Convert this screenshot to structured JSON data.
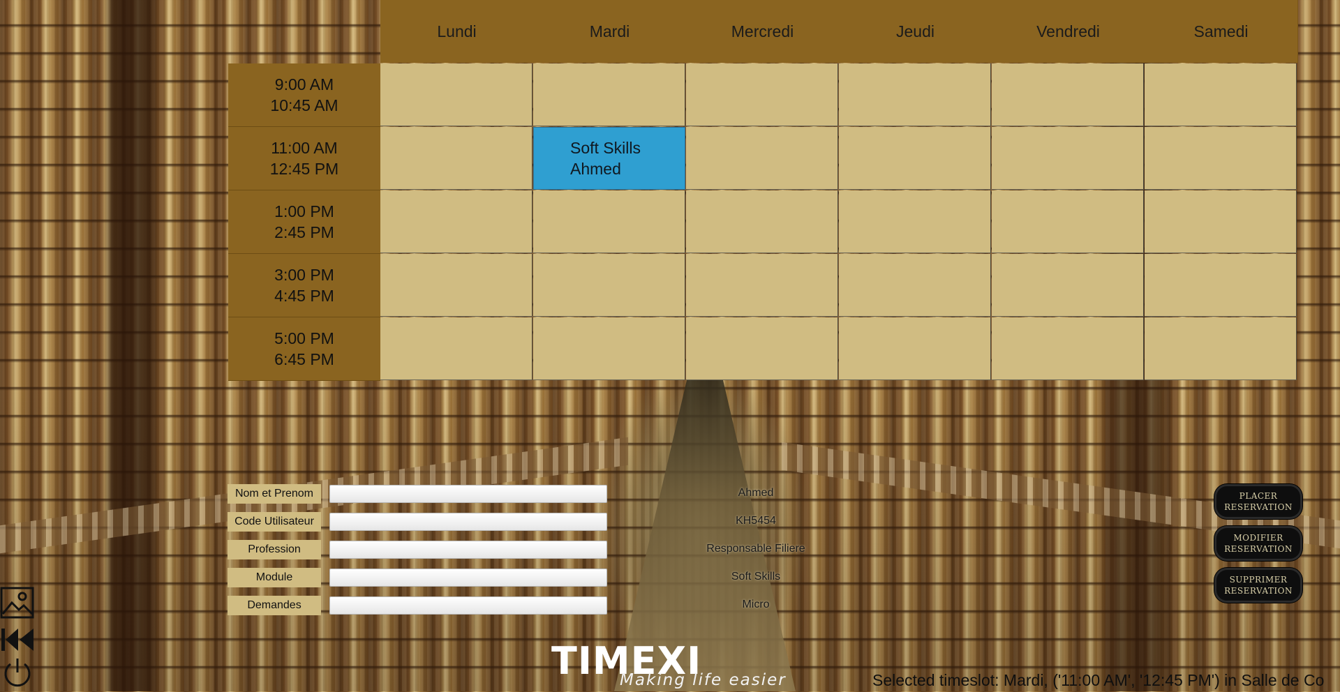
{
  "timetable": {
    "days": [
      "Lundi",
      "Mardi",
      "Mercredi",
      "Jeudi",
      "Vendredi",
      "Samedi"
    ],
    "timeslots": [
      {
        "start": "9:00 AM",
        "end": "10:45 AM"
      },
      {
        "start": "11:00 AM",
        "end": "12:45 PM"
      },
      {
        "start": "1:00 PM",
        "end": "2:45 PM"
      },
      {
        "start": "3:00 PM",
        "end": "4:45 PM"
      },
      {
        "start": "5:00 PM",
        "end": "6:45 PM"
      }
    ],
    "booking": {
      "module": "Soft Skills",
      "person": "Ahmed",
      "day": "Mardi",
      "slot": "11:00 AM"
    }
  },
  "form": {
    "labels": {
      "name": "Nom et Prenom",
      "code": "Code Utilisateur",
      "profession": "Profession",
      "module": "Module",
      "demandes": "Demandes"
    },
    "inputs": {
      "name": "",
      "code": "",
      "profession": "",
      "module": "",
      "demandes": ""
    },
    "values": {
      "name": "Ahmed",
      "code": "KH5454",
      "profession": "Responsable Filiere",
      "module": "Soft Skills",
      "demandes": "Micro"
    }
  },
  "actions": {
    "place": [
      "placer",
      "reservation"
    ],
    "modify": [
      "modifier",
      "reservation"
    ],
    "delete": [
      "supprimer",
      "reservation"
    ]
  },
  "side_icons": [
    "image-icon",
    "rewind-icon",
    "power-icon"
  ],
  "branding": {
    "name": "TIMEXI",
    "tagline": "Making life easier"
  },
  "status": {
    "text": "Selected timeslot: Mardi, ('11:00 AM', '12:45 PM') in Salle de Co"
  },
  "colors": {
    "header": "#8a6420",
    "cell": "#d0bc82",
    "booked": "#2f9fd1"
  }
}
